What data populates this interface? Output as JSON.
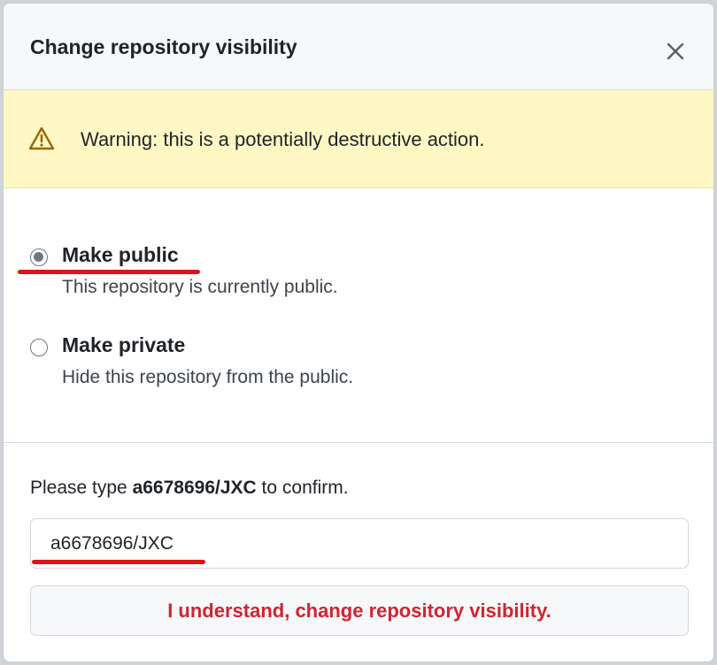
{
  "dialog": {
    "title": "Change repository visibility",
    "close_icon": "close-icon"
  },
  "warning": {
    "icon": "alert-triangle-icon",
    "text": "Warning: this is a potentially destructive action."
  },
  "options": [
    {
      "label": "Make public",
      "description": "This repository is currently public.",
      "checked": true
    },
    {
      "label": "Make private",
      "description": "Hide this repository from the public.",
      "checked": false
    }
  ],
  "confirm": {
    "prefix": "Please type ",
    "repo_name": "a6678696/JXC",
    "suffix": " to confirm.",
    "input_value": "a6678696/JXC"
  },
  "action_button": {
    "label": "I understand, change repository visibility."
  },
  "colors": {
    "header_bg": "#f6f8fa",
    "warning_bg": "#fff8c5",
    "warning_icon": "#9a6700",
    "danger_text": "#d1242f",
    "annotation_underline": "#e0121b"
  }
}
